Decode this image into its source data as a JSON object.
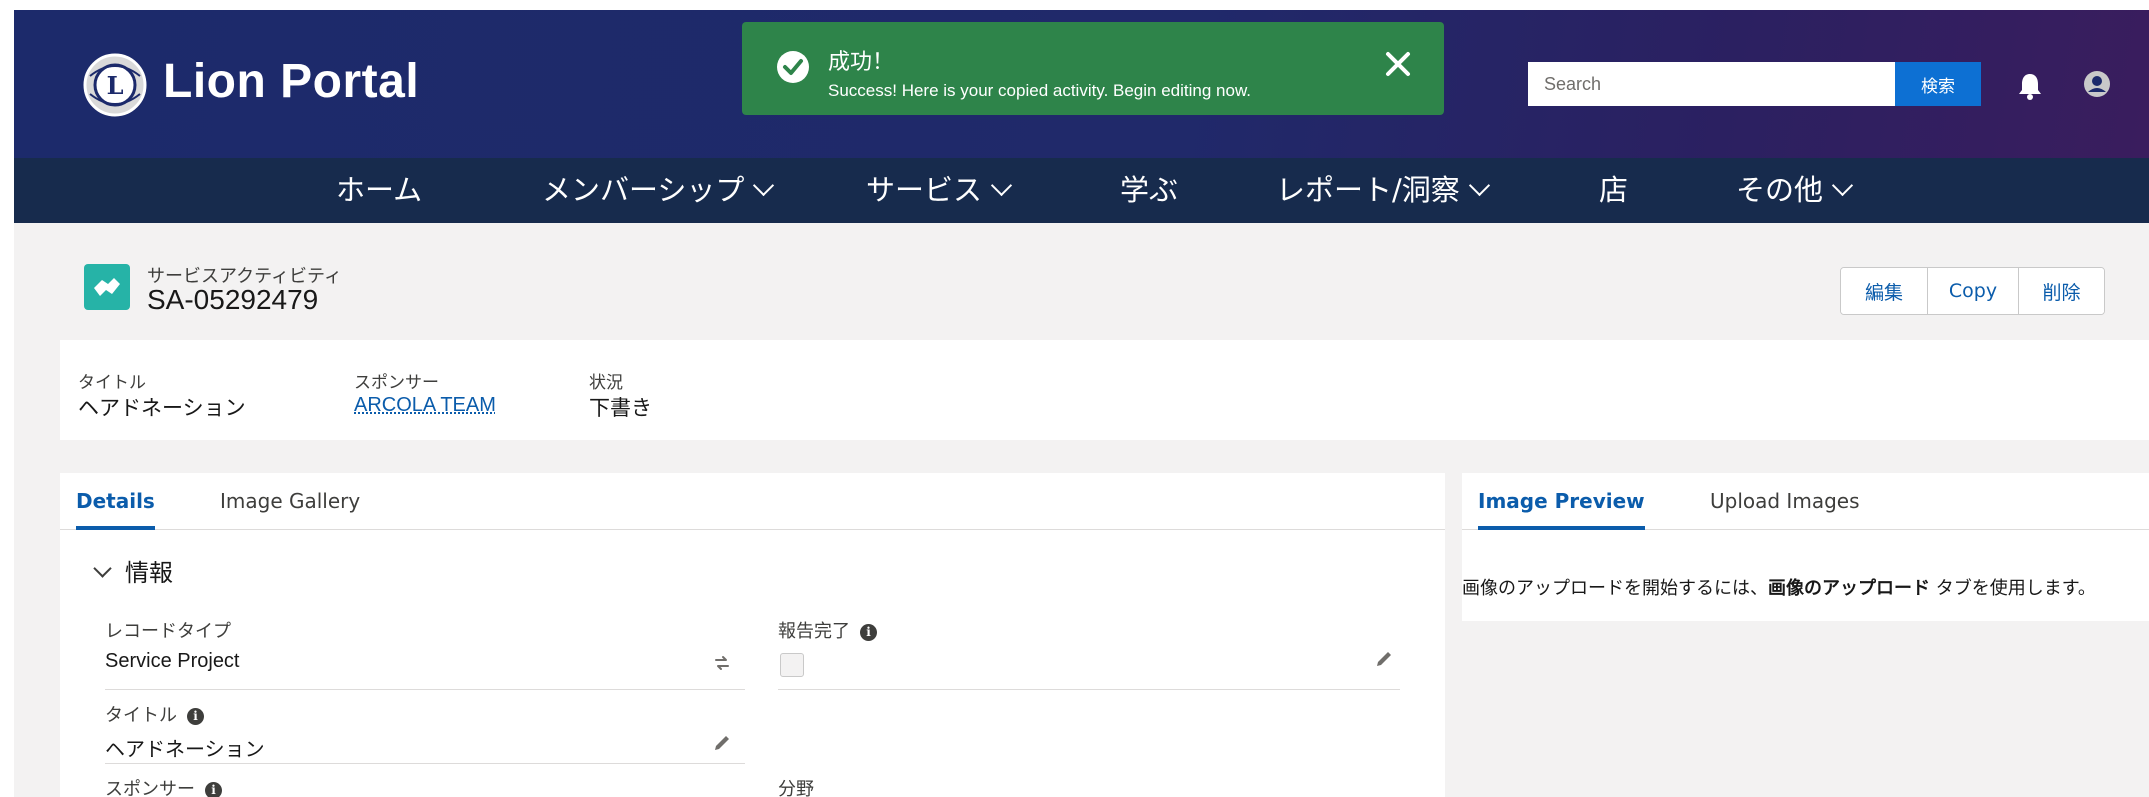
{
  "header": {
    "brand": "Lion Portal",
    "search_placeholder": "Search",
    "search_button": "検索"
  },
  "toast": {
    "title": "成功！",
    "message": "Success! Here is your copied activity. Begin editing now."
  },
  "nav": {
    "items": [
      {
        "label": "ホーム",
        "dropdown": false
      },
      {
        "label": "メンバーシップ",
        "dropdown": true
      },
      {
        "label": "サービス",
        "dropdown": true
      },
      {
        "label": "学ぶ",
        "dropdown": false
      },
      {
        "label": "レポート/洞察",
        "dropdown": true
      },
      {
        "label": "店",
        "dropdown": false
      },
      {
        "label": "その他",
        "dropdown": true
      }
    ]
  },
  "record": {
    "object_type": "サービスアクティビティ",
    "name": "SA-05292479",
    "actions": {
      "edit": "編集",
      "copy": "Copy",
      "delete": "削除"
    }
  },
  "highlights": {
    "title_label": "タイトル",
    "title_value": "ヘアドネーション",
    "sponsor_label": "スポンサー",
    "sponsor_value": "ARCOLA TEAM",
    "status_label": "状況",
    "status_value": "下書き"
  },
  "details_tabs": {
    "details": "Details",
    "image_gallery": "Image Gallery"
  },
  "section": {
    "title": "情報"
  },
  "fields": {
    "record_type_label": "レコードタイプ",
    "record_type_value": "Service Project",
    "report_complete_label": "報告完了",
    "title_label": "タイトル",
    "title_value": "ヘアドネーション",
    "sponsor_label": "スポンサー",
    "field_label": "分野"
  },
  "preview_tabs": {
    "image_preview": "Image Preview",
    "upload_images": "Upload Images"
  },
  "preview": {
    "text_before": "画像のアップロードを開始するには、",
    "text_bold": "画像のアップロード",
    "text_after": " タブを使用します。"
  },
  "colors": {
    "header_gradient_start": "#1c2a6b",
    "header_gradient_end": "#3a1d5e",
    "nav_bg": "#172b4d",
    "toast_bg": "#2e844a",
    "brand_blue": "#0b5cab",
    "record_icon": "#26b3a7"
  },
  "icons": [
    "lions-logo-icon",
    "bell-icon",
    "user-avatar-icon",
    "check-circle-icon",
    "close-icon",
    "handshake-icon",
    "swap-icon",
    "pencil-icon",
    "info-icon",
    "chevron-down-icon"
  ]
}
